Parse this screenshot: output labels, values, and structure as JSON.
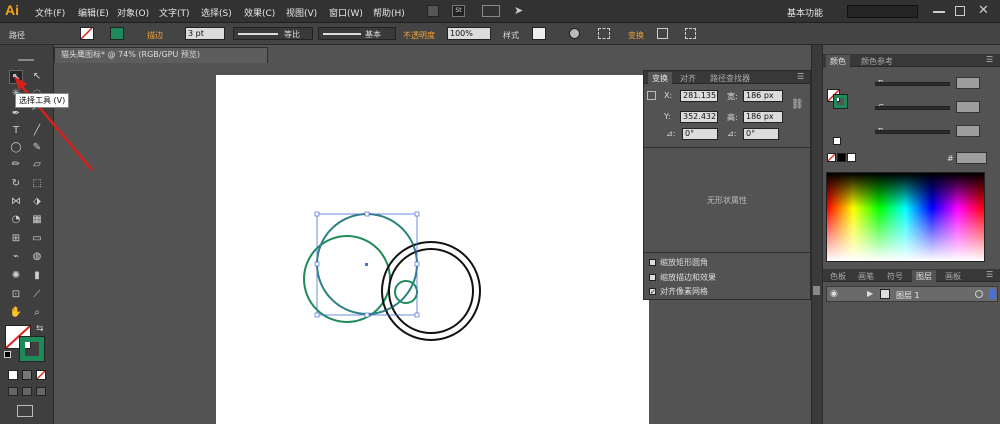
{
  "app": {
    "logo": "Ai"
  },
  "menu": [
    "文件(F)",
    "编辑(E)",
    "对象(O)",
    "文字(T)",
    "选择(S)",
    "效果(C)",
    "视图(V)",
    "窗口(W)",
    "帮助(H)"
  ],
  "menu_right": {
    "workspace": "基本功能"
  },
  "control": {
    "context_label": "路径",
    "stroke_label": "描边",
    "stroke_value": "3 pt",
    "profile_label": "等比",
    "brush_label": "基本",
    "opacity_label": "不透明度",
    "opacity_value": "100%",
    "style_label": "样式",
    "transform_label": "变换"
  },
  "document": {
    "tab_title": "猫头鹰图标* @ 74% (RGB/GPU 预览)"
  },
  "tooltip": {
    "text": "选择工具 (V)"
  },
  "transform_panel": {
    "tabs": [
      "变换",
      "对齐",
      "路径查找器"
    ],
    "x_label": "X:",
    "x_value": "281.135",
    "y_label": "Y:",
    "y_value": "352.432",
    "w_label": "宽:",
    "w_value": "186 px",
    "h_label": "高:",
    "h_value": "186 px",
    "angle_value": "0°",
    "shear_value": "0°",
    "no_shape": "无形状属性",
    "options": [
      {
        "label": "缩放矩形圆角",
        "checked": false
      },
      {
        "label": "缩放描边和效果",
        "checked": false
      },
      {
        "label": "对齐像素网格",
        "checked": true
      }
    ]
  },
  "color_panel": {
    "tabs": [
      "颜色",
      "颜色参考"
    ],
    "channels": [
      "R",
      "G",
      "B"
    ],
    "hex_label": "#"
  },
  "layers_panel": {
    "tabs": [
      "色板",
      "画笔",
      "符号",
      "图层",
      "画板"
    ],
    "layer_name": "图层 1"
  },
  "colors": {
    "accent": "#f7a21b",
    "selection": "#4b6fd8",
    "green_stroke": "#1e8a5a",
    "stroke_red": "#e0201c"
  }
}
